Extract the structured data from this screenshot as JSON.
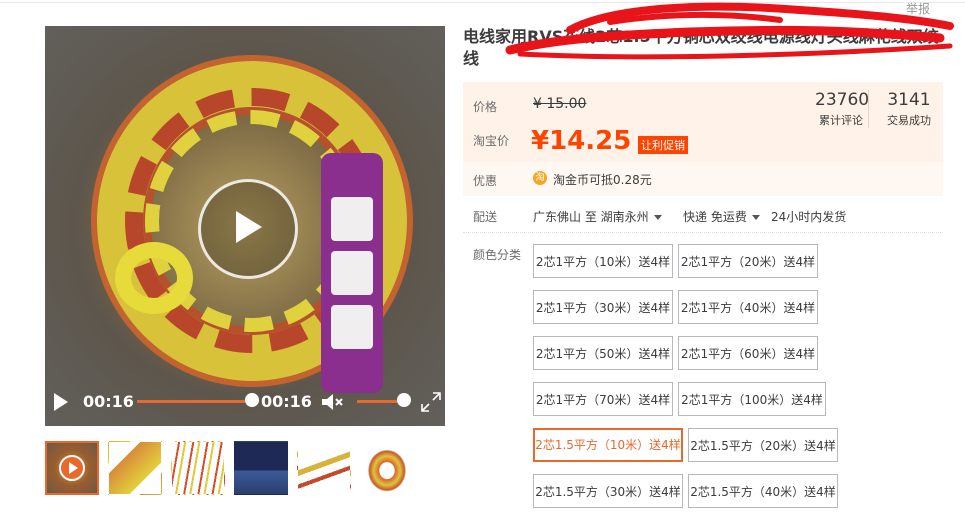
{
  "report_label": "举报",
  "product": {
    "title": "电线家用RVS花线2芯1.5平方铜芯双绞线电源线灯头线麻花线双绞线"
  },
  "video": {
    "current_time": "00:16",
    "duration": "00:16",
    "progress": 1.0,
    "volume": 0.8
  },
  "thumbnails": [
    "video-thumb",
    "socket-promo",
    "wire-samples",
    "spec-sheet",
    "wire-ends",
    "coil"
  ],
  "price": {
    "label": "价格",
    "original": "¥ 15.00",
    "taobao_label": "淘宝价",
    "current": "¥14.25",
    "promo_badge": "让利促销"
  },
  "stats": {
    "reviews_count": "23760",
    "reviews_label": "累计评论",
    "sales_count": "3141",
    "sales_label": "交易成功"
  },
  "discount": {
    "label": "优惠",
    "coin_icon_text": "淘",
    "text": "淘金币可抵0.28元"
  },
  "shipping": {
    "label": "配送",
    "route": "广东佛山 至  湖南永州",
    "method": "快递 免运费",
    "dispatch": "24小时内发货"
  },
  "colors": {
    "label": "颜色分类",
    "options": [
      "2芯1平方（10米）送4样",
      "2芯1平方（20米）送4样",
      "2芯1平方（30米）送4样",
      "2芯1平方（40米）送4样",
      "2芯1平方（50米）送4样",
      "2芯1平方（60米）送4样",
      "2芯1平方（70米）送4样",
      "2芯1平方（100米）送4样",
      "2芯1.5平方（10米）送4样",
      "2芯1.5平方（20米）送4样",
      "2芯1.5平方（30米）送4样",
      "2芯1.5平方（40米）送4样"
    ],
    "selected_index": 8
  },
  "theme": {
    "accent": "#e8692b",
    "price_red": "#ff4400",
    "price_bg": "#fff2e8"
  }
}
